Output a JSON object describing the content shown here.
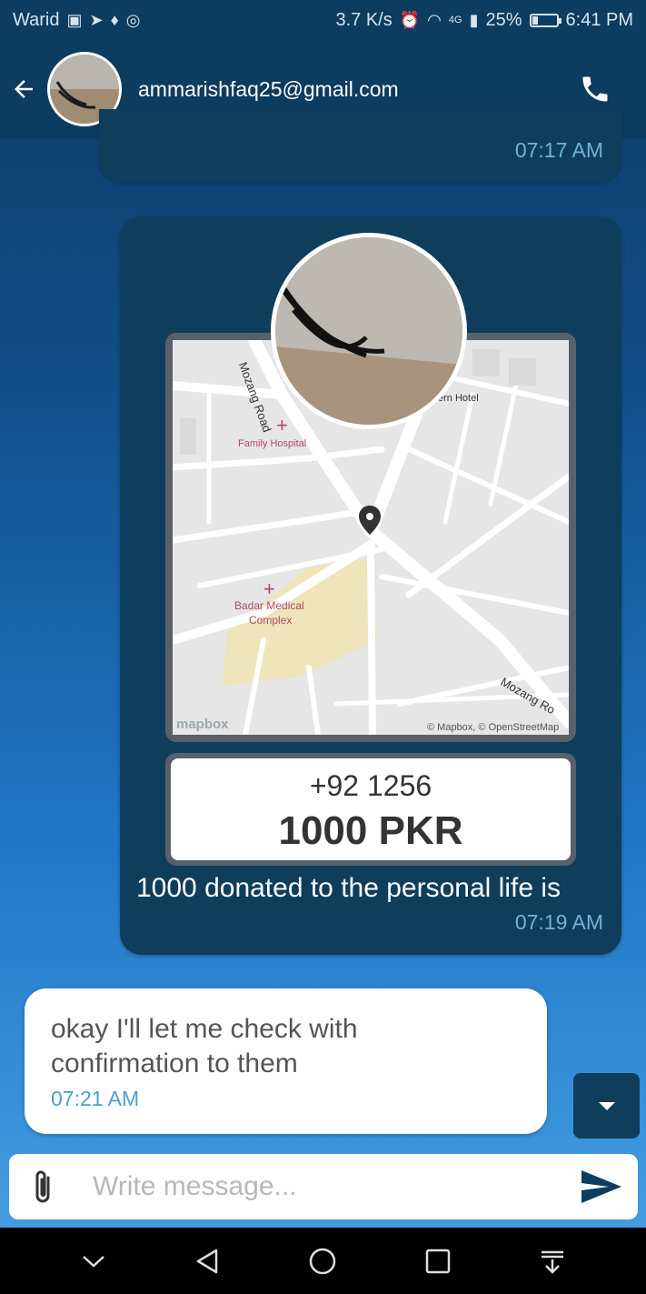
{
  "status_bar": {
    "carrier": "Warid",
    "net_speed": "3.7 K/s",
    "network": "4G",
    "battery": "25%",
    "battery_level": 0.25,
    "time": "6:41 PM"
  },
  "header": {
    "contact": "ammarishfaq25@gmail.com"
  },
  "messages": {
    "previous_time": "07:17 AM",
    "donation": {
      "map_labels": {
        "road_top": "Mozang Road",
        "hotel": "ern Hotel",
        "hospital": "Family Hospital",
        "medical_line1": "Badar Medical",
        "medical_line2": "Complex",
        "road_bottom": "Mozang Ro",
        "mapbox": "mapbox",
        "attribution": "© Mapbox, © OpenStreetMap"
      },
      "phone": "+92 1256",
      "amount": "1000 PKR",
      "caption": "1000 donated to the personal life is",
      "time": "07:19 AM"
    },
    "reply": {
      "text": "okay I'll let me check with confirmation to them",
      "time": "07:21 AM"
    }
  },
  "composer": {
    "placeholder": "Write message..."
  },
  "colors": {
    "header_bg": "#0c3c60",
    "bubble_out": "#0f3d5c",
    "time_text": "#6fb3d8"
  }
}
